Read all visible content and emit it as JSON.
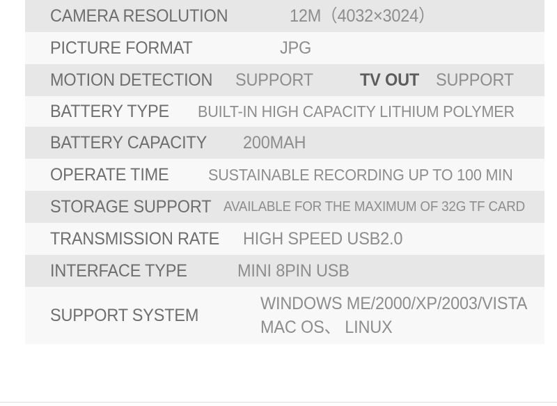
{
  "table": {
    "rows": [
      {
        "label": "CAMERA RESOLUTION",
        "value": "12M（4032×3024）"
      },
      {
        "label": "PICTURE FORMAT",
        "value": "JPG"
      },
      {
        "label": "MOTION DETECTION",
        "value": "SUPPORT",
        "label2": "TV OUT",
        "value2": "SUPPORT"
      },
      {
        "label": "BATTERY TYPE",
        "value": "BUILT-IN HIGH CAPACITY LITHIUM POLYMER"
      },
      {
        "label": "BATTERY CAPACITY",
        "value": "200MAH"
      },
      {
        "label": "OPERATE TIME",
        "value": "SUSTAINABLE RECORDING UP TO 100 MIN"
      },
      {
        "label": "STORAGE SUPPORT",
        "value": "AVAILABLE FOR THE MAXIMUM OF 32G TF CARD"
      },
      {
        "label": "TRANSMISSION RATE",
        "value": "HIGH SPEED USB2.0"
      },
      {
        "label": "INTERFACE TYPE",
        "value": "MINI 8PIN USB"
      },
      {
        "label": "SUPPORT SYSTEM",
        "value_line1": "WINDOWS ME/2000/XP/2003/VISTA",
        "value_line2": "MAC OS、 LINUX"
      }
    ]
  },
  "colors": {
    "row_shade_dark": "#e7e7e7",
    "row_shade_light": "#f8f8f8",
    "label_text": "#6e6e6e",
    "value_text": "#8d8d8d",
    "emphasis_text": "#5c5c5c",
    "page_background": "#ffffff",
    "bottom_rule": "#dcdcdc"
  }
}
